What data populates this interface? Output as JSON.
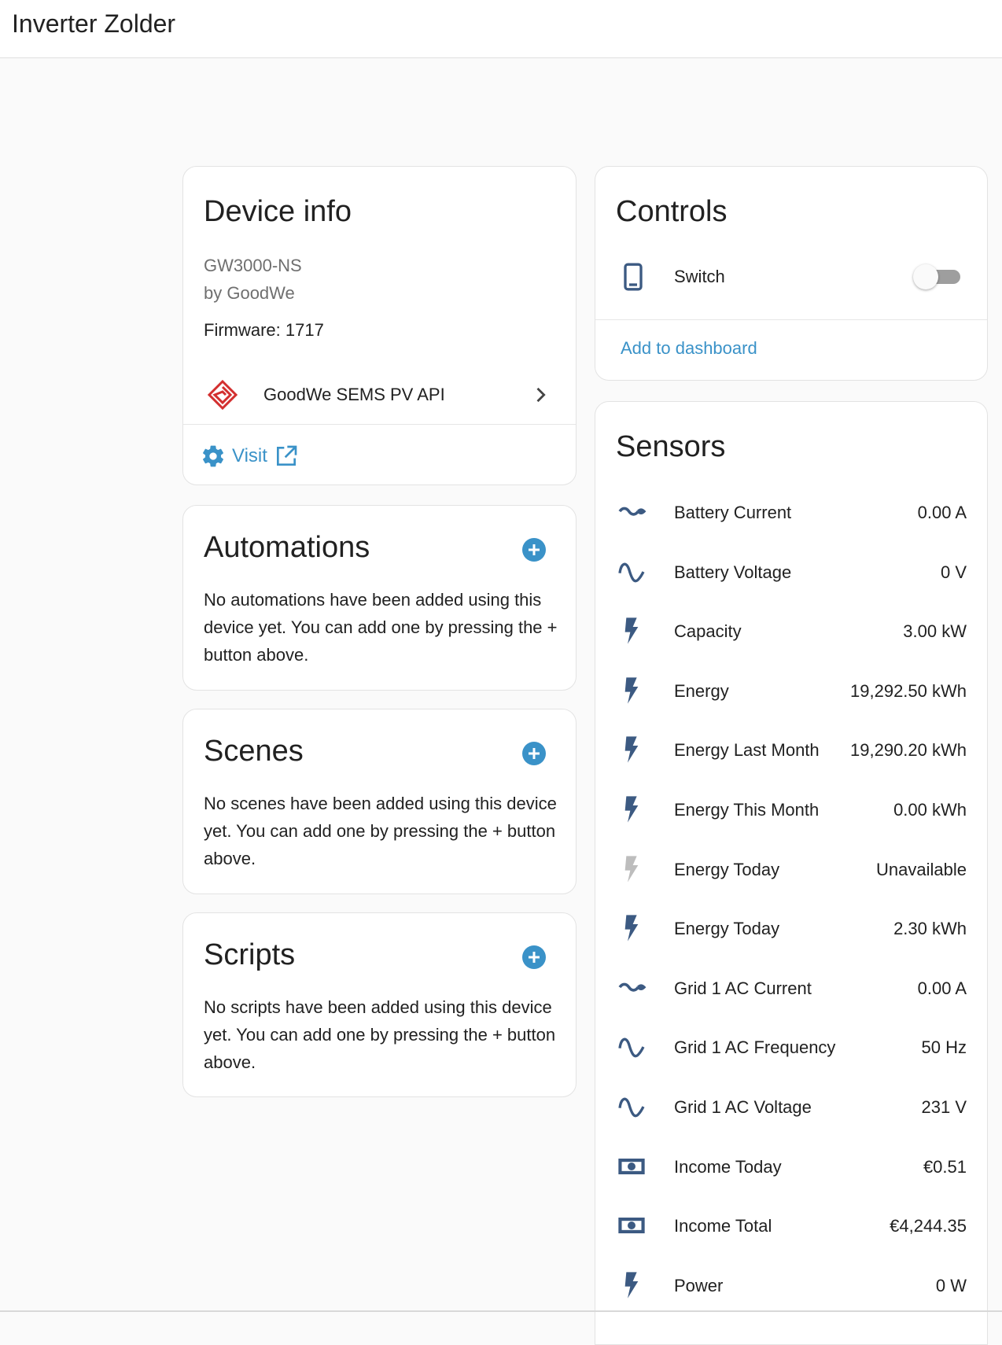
{
  "header": {
    "title": "Inverter Zolder"
  },
  "colors": {
    "accent": "#3a92c8",
    "icon": "#3c5a82",
    "icon_disabled": "#bdbdbd",
    "brand": "#d32f2f"
  },
  "device_info": {
    "title": "Device info",
    "model": "GW3000-NS",
    "manufacturer": "by GoodWe",
    "firmware": "Firmware: 1717",
    "integration": {
      "icon": "goodwe-logo-icon",
      "label": "GoodWe SEMS PV API"
    },
    "visit_label": "Visit"
  },
  "automations": {
    "title": "Automations",
    "text": "No automations have been added using this device yet. You can add one by pressing the + button above."
  },
  "scenes": {
    "title": "Scenes",
    "text": "No scenes have been added using this device yet. You can add one by pressing the + button above."
  },
  "scripts": {
    "title": "Scripts",
    "text": "No scripts have been added using this device yet. You can add one by pressing the + button above."
  },
  "controls": {
    "title": "Controls",
    "switch": {
      "icon": "phone-icon",
      "label": "Switch",
      "state": "off"
    },
    "add_to_dashboard": "Add to dashboard"
  },
  "sensors": {
    "title": "Sensors",
    "items": [
      {
        "icon": "current-ac-icon",
        "name": "Battery Current",
        "value": "0.00 A"
      },
      {
        "icon": "sine-wave-icon",
        "name": "Battery Voltage",
        "value": "0 V"
      },
      {
        "icon": "flash-icon",
        "name": "Capacity",
        "value": "3.00 kW"
      },
      {
        "icon": "flash-icon",
        "name": "Energy",
        "value": "19,292.50 kWh"
      },
      {
        "icon": "flash-icon",
        "name": "Energy Last Month",
        "value": "19,290.20 kWh"
      },
      {
        "icon": "flash-icon",
        "name": "Energy This Month",
        "value": "0.00 kWh"
      },
      {
        "icon": "flash-disabled-icon",
        "name": "Energy Today",
        "value": "Unavailable"
      },
      {
        "icon": "flash-icon",
        "name": "Energy Today",
        "value": "2.30 kWh"
      },
      {
        "icon": "current-ac-icon",
        "name": "Grid 1 AC Current",
        "value": "0.00 A"
      },
      {
        "icon": "sine-wave-icon",
        "name": "Grid 1 AC Frequency",
        "value": "50 Hz"
      },
      {
        "icon": "sine-wave-icon",
        "name": "Grid 1 AC Voltage",
        "value": "231 V"
      },
      {
        "icon": "cash-icon",
        "name": "Income Today",
        "value": "€0.51"
      },
      {
        "icon": "cash-icon",
        "name": "Income Total",
        "value": "€4,244.35"
      },
      {
        "icon": "flash-icon",
        "name": "Power",
        "value": "0 W"
      }
    ]
  }
}
